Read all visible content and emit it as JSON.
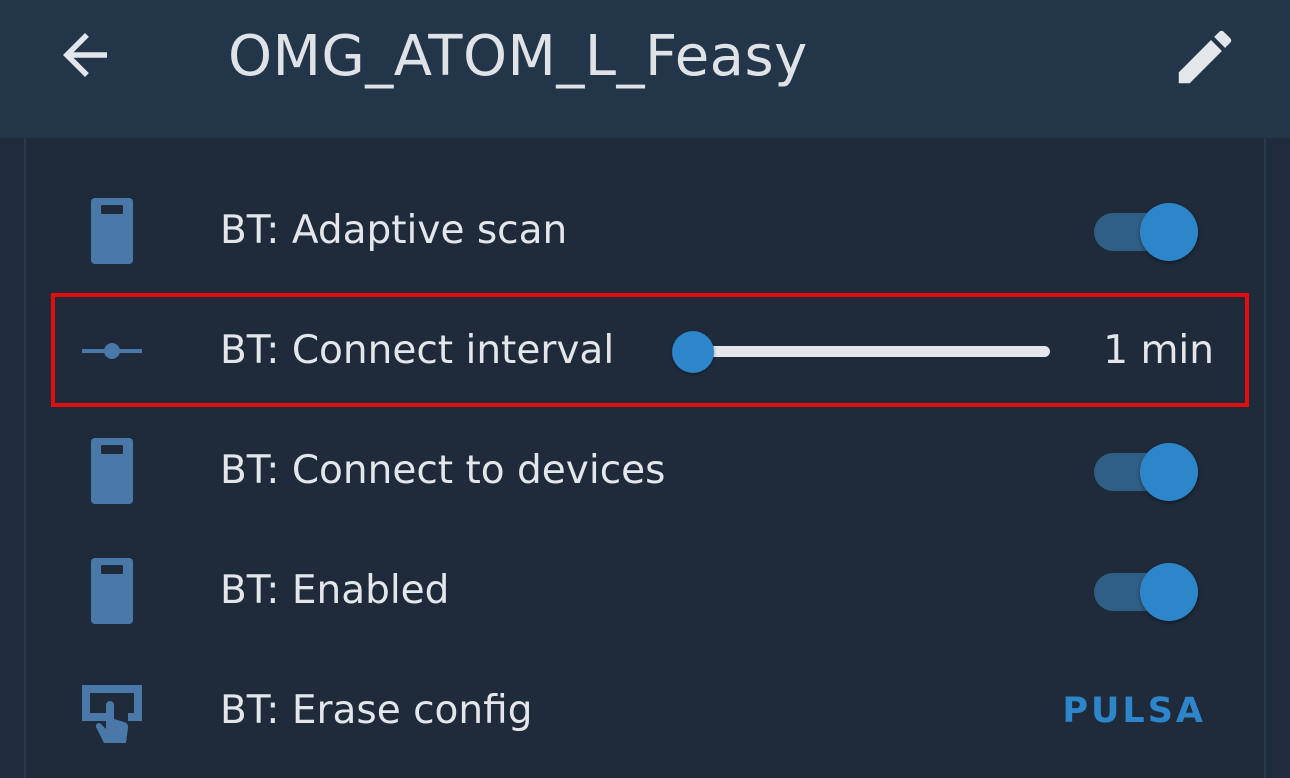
{
  "appbar": {
    "title": "OMG_ATOM_L_Feasy",
    "back_icon": "arrow-left-icon",
    "edit_icon": "pencil-icon"
  },
  "colors": {
    "background": "#1f2c3d",
    "appbar": "#233549",
    "accent": "#2c86c9",
    "icon": "#4a78a8",
    "highlight": "#e10e0e"
  },
  "rows": [
    {
      "label": "BT: Adaptive scan",
      "icon": "bluetooth-device-icon",
      "control": "toggle",
      "on": true
    },
    {
      "label": "BT: Connect interval",
      "icon": "slider-horizontal-icon",
      "control": "slider",
      "value_text": "1 min",
      "fraction": 0.0
    },
    {
      "label": "BT: Connect to devices",
      "icon": "bluetooth-device-icon",
      "control": "toggle",
      "on": true
    },
    {
      "label": "BT: Enabled",
      "icon": "bluetooth-device-icon",
      "control": "toggle",
      "on": true
    },
    {
      "label": "BT: Erase config",
      "icon": "gesture-tap-button-icon",
      "control": "button",
      "button_label": "PULSA"
    }
  ]
}
